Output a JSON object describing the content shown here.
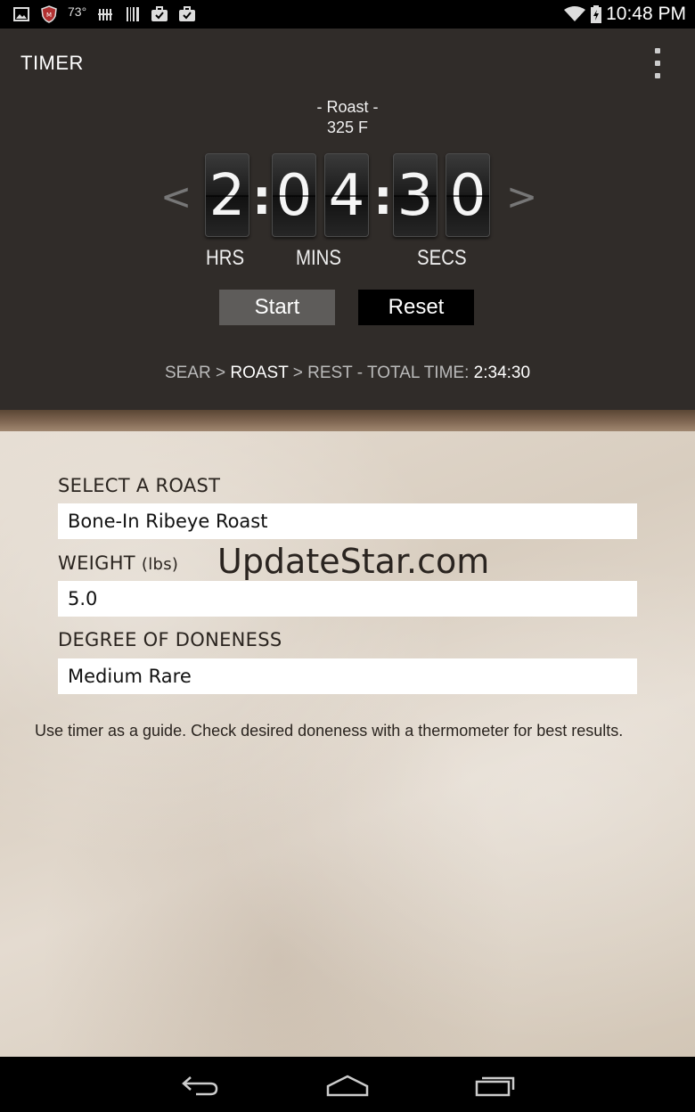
{
  "status_bar": {
    "temperature": "73°",
    "time": "10:48 PM",
    "icons": [
      "gallery-icon",
      "security-shield-icon",
      "signal-bars-icon",
      "barcode-icon",
      "briefcase-icon",
      "download-icon",
      "wifi-icon",
      "battery-icon"
    ]
  },
  "app_bar": {
    "title": "TIMER",
    "menu_icon": "overflow-menu-icon"
  },
  "timer": {
    "stage_name": "- Roast -",
    "stage_temp": "325 F",
    "prev_arrow": "<",
    "next_arrow": ">",
    "digits": {
      "h": "2",
      "m1": "0",
      "m2": "4",
      "s1": "3",
      "s2": "0"
    },
    "separator": ":",
    "units": {
      "hours": "HRS",
      "minutes": "MINS",
      "seconds": "SECS"
    },
    "start_label": "Start",
    "reset_label": "Reset"
  },
  "sequence": {
    "sear": "SEAR",
    "sep1": " > ",
    "roast": "ROAST",
    "sep2": " > ",
    "rest": "REST",
    "total_label": " - TOTAL TIME: ",
    "total_time": "2:34:30"
  },
  "form": {
    "roast_label": "SELECT A ROAST",
    "roast_value": "Bone-In Ribeye Roast",
    "weight_label": "WEIGHT",
    "weight_unit": "(lbs)",
    "weight_value": "5.0",
    "doneness_label": "DEGREE OF DONENESS",
    "doneness_value": "Medium Rare",
    "note": "Use timer as a guide. Check desired doneness with a thermometer for best results."
  },
  "watermark": "UpdateStar.com",
  "nav_bar": {
    "icons": [
      "back-icon",
      "home-icon",
      "recent-apps-icon"
    ]
  }
}
